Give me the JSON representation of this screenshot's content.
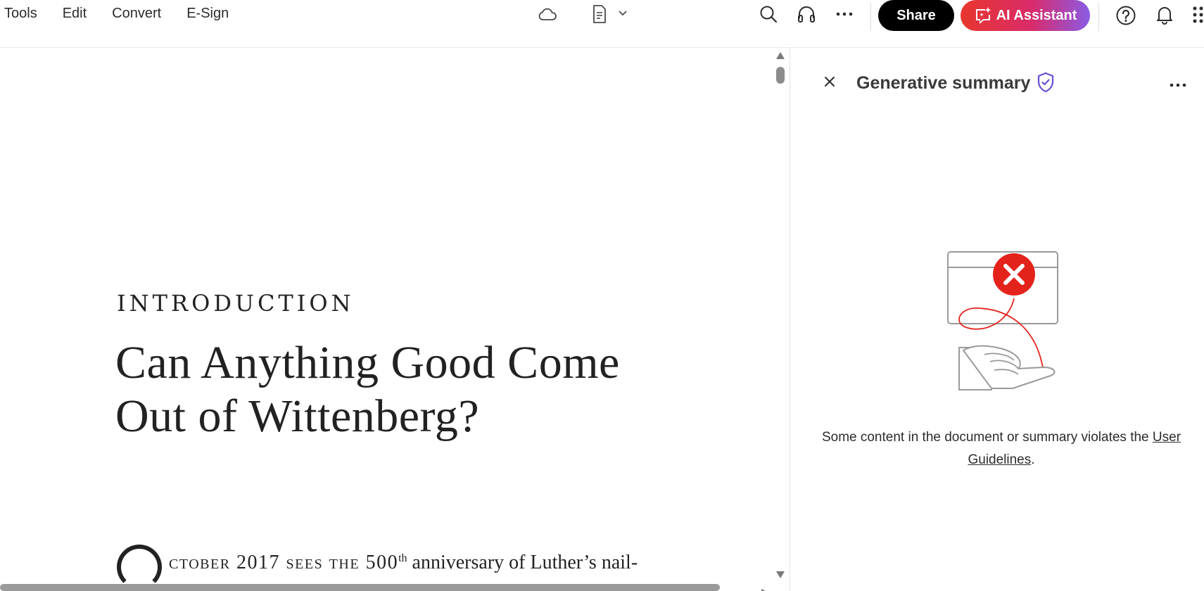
{
  "menu": {
    "items": [
      "Tools",
      "Edit",
      "Convert",
      "E-Sign"
    ]
  },
  "toolbar": {
    "share_label": "Share",
    "ai_assistant_label": "AI Assistant",
    "icons": [
      "cloud-icon",
      "document-icon",
      "chevron-down-icon",
      "search-icon",
      "headphones-icon",
      "more-icon",
      "help-icon",
      "bell-icon",
      "apps-grid-icon"
    ]
  },
  "document": {
    "section_label": "INTRODUCTION",
    "title_line1": "Can Anything Good Come",
    "title_line2": "Out of Wittenberg?",
    "opening_smallcaps": "ctober 2017 sees the 500",
    "opening_superscript": "th",
    "opening_rest": "anniversary of Luther’s nail-"
  },
  "panel": {
    "title": "Generative summary",
    "message_text": "Some content in the document or summary violates the",
    "message_link": "User Guidelines",
    "message_end": "."
  },
  "colors": {
    "share_bg": "#000000",
    "ai_gradient_start": "#e8362d",
    "ai_gradient_end": "#8a5be6",
    "error_red": "#e4221c",
    "shield_purple": "#6a4fd6"
  }
}
